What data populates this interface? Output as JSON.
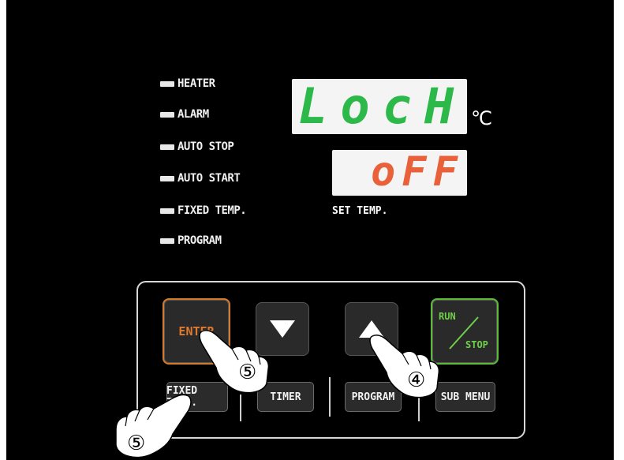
{
  "indicators": [
    {
      "label": "HEATER"
    },
    {
      "label": "ALARM"
    },
    {
      "label": "AUTO STOP"
    },
    {
      "label": "AUTO START"
    },
    {
      "label": "FIXED TEMP."
    },
    {
      "label": "PROGRAM"
    }
  ],
  "display": {
    "main_text": "LocH",
    "unit": "℃",
    "set_text": "oFF",
    "set_label": "SET TEMP."
  },
  "keypad": {
    "enter_label": "ENTER",
    "run_label": "RUN",
    "stop_label": "STOP",
    "fixed_temp_label": "FIXED TEMP.",
    "timer_label": "TIMER",
    "program_label": "PROGRAM",
    "sub_menu_label": "SUB MENU"
  },
  "callouts": {
    "enter_step": "⑤",
    "fixed_step": "⑤",
    "up_step": "④"
  },
  "colors": {
    "main_display": "#2db84a",
    "set_display": "#e8613a",
    "enter_border": "#d47a2a",
    "run_border": "#5dbb3a"
  }
}
